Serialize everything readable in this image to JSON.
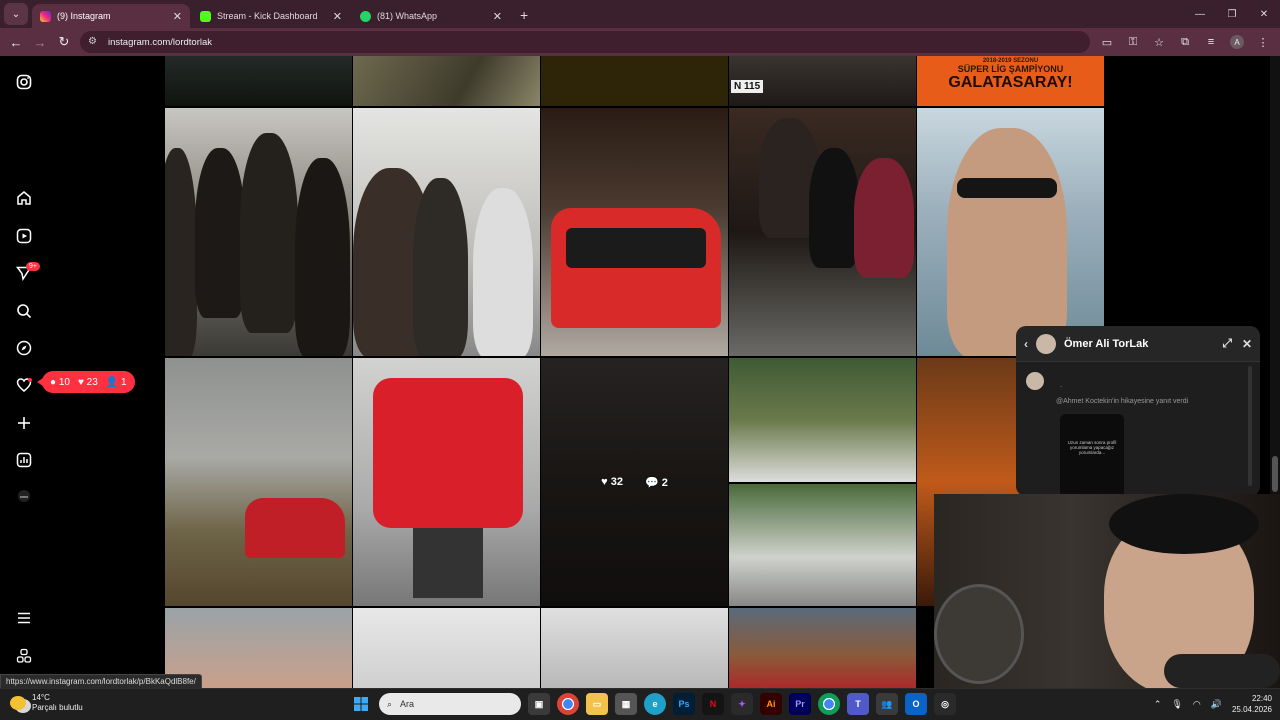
{
  "browser": {
    "tabs": [
      {
        "label": "(9) Instagram",
        "icon": "instagram-icon",
        "color": "#e1306c",
        "active": true
      },
      {
        "label": "Stream - Kick Dashboard",
        "icon": "kick-icon",
        "color": "#53fc18",
        "active": false
      },
      {
        "label": "(81) WhatsApp",
        "icon": "whatsapp-icon",
        "color": "#25d366",
        "active": false
      }
    ],
    "url": "instagram.com/lordtorlak",
    "profile_initial": "A"
  },
  "instagram": {
    "nav_badge": "9+",
    "notifications": {
      "comments": "10",
      "likes": "23",
      "followers": "1"
    },
    "hover_stats": {
      "likes": "32",
      "comments": "2"
    },
    "top_banner": {
      "season": "2018-2019 SEZONU",
      "line1": "SÜPER LİG ŞAMPİYONU",
      "line2": "GALATASARAY!"
    },
    "plate": "N 115"
  },
  "chat": {
    "name": "Ömer Ali TorLak",
    "dot": ".",
    "reply_note": "@Ahmet Koctekin'in hikayesine yanıt verdi",
    "story_text": "Uzun zaman sonra profil yorumlama yapacağız yorumlarda..."
  },
  "status_url": "https://www.instagram.com/lordtorlak/p/BkKaQdlB8fe/",
  "taskbar": {
    "temp": "14°C",
    "weather": "Parçalı bulutlu",
    "search": "Ara",
    "time": "22:40",
    "date": "25.04.2026"
  }
}
